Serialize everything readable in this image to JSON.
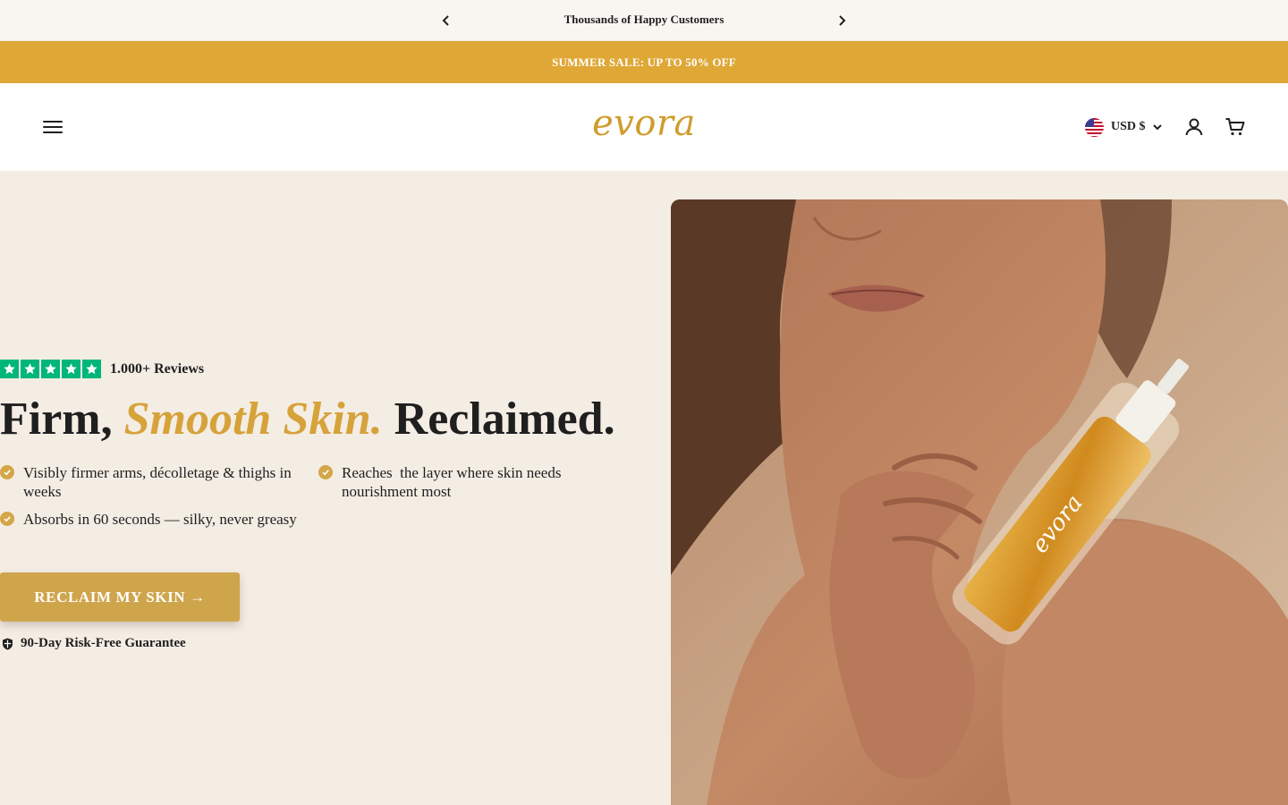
{
  "announcement": {
    "message": "Thousands of Happy Customers",
    "prev_label": "Previous announcement",
    "next_label": "Next announcement"
  },
  "sale_banner": {
    "text": "SUMMER SALE: UP TO 50% OFF"
  },
  "header": {
    "logo": "evora",
    "currency": "USD $",
    "icons": {
      "menu": "hamburger-menu-icon",
      "flag": "us-flag-icon",
      "dropdown": "chevron-down-icon",
      "account": "user-icon",
      "cart": "cart-icon"
    }
  },
  "hero": {
    "rating": {
      "stars": 5,
      "reviews": "1.000+ Reviews"
    },
    "headline": {
      "part1": "Firm,",
      "accent": "Smooth Skin.",
      "part2": "Reclaimed."
    },
    "benefits": [
      "Visibly firmer arms, décolletage & thighs in weeks",
      "Reaches  the layer where skin needs nourishment most",
      "Absorbs in 60 seconds — silky, never greasy"
    ],
    "cta": "RECLAIM MY SKIN →",
    "guarantee": "90-Day Risk-Free Guarantee",
    "product_label": "evora"
  },
  "colors": {
    "gold": "#dfa735",
    "logo_gold": "#cf9d2c",
    "accent_text": "#d6a23a",
    "cta": "#cfa54c",
    "trustpilot_green": "#00b67a",
    "hero_bg": "#f4ede4"
  }
}
